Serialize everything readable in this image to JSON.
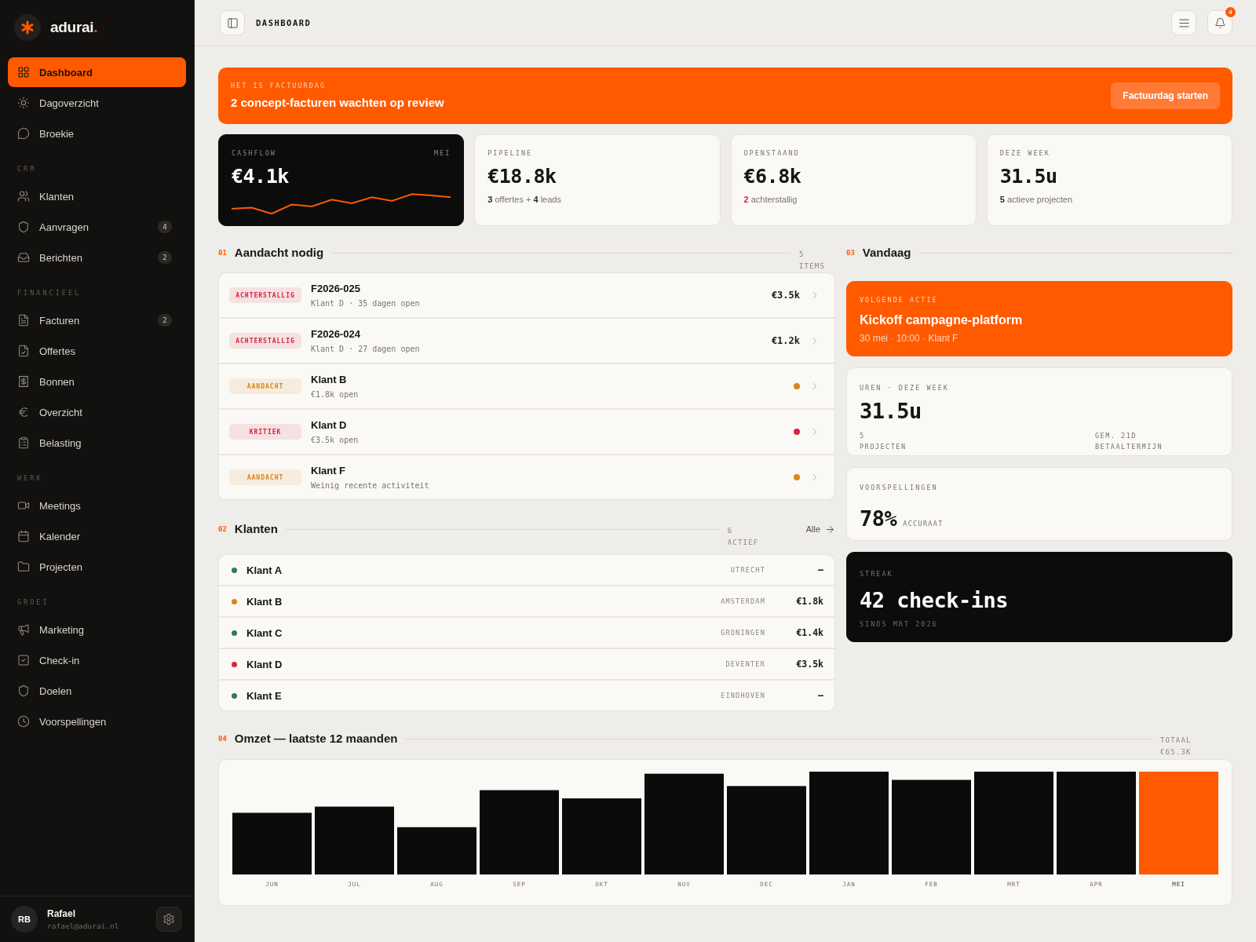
{
  "sidebar": {
    "brand": {
      "name": "adurai",
      "dot": "."
    },
    "groups": [
      {
        "items": [
          {
            "label": "Dashboard",
            "selected": true
          },
          {
            "label": "Dagoverzicht",
            "selected": false
          },
          {
            "label": "Broekie",
            "selected": false
          }
        ]
      },
      {
        "title": "CRM",
        "items": [
          {
            "label": "Klanten",
            "selected": false
          },
          {
            "label": "Aanvragen",
            "selected": false,
            "badge": "4"
          },
          {
            "label": "Berichten",
            "selected": false,
            "badge": "2"
          }
        ]
      },
      {
        "title": "FINANCIEEL",
        "items": [
          {
            "label": "Facturen",
            "selected": false,
            "badge": "2"
          },
          {
            "label": "Offertes",
            "selected": false
          },
          {
            "label": "Bonnen",
            "selected": false
          },
          {
            "label": "Overzicht",
            "selected": false
          },
          {
            "label": "Belasting",
            "selected": false
          }
        ]
      },
      {
        "title": "WERK",
        "items": [
          {
            "label": "Meetings",
            "selected": false
          },
          {
            "label": "Kalender",
            "selected": false
          },
          {
            "label": "Projecten",
            "selected": false
          }
        ]
      },
      {
        "title": "GROEI",
        "items": [
          {
            "label": "Marketing",
            "selected": false
          },
          {
            "label": "Check-in",
            "selected": false
          },
          {
            "label": "Doelen",
            "selected": false
          },
          {
            "label": "Voorspellingen",
            "selected": false
          }
        ]
      }
    ],
    "user": {
      "initials": "RB",
      "name": "Rafael",
      "email": "rafael@adurai.nl"
    }
  },
  "topbar": {
    "title": "DASHBOARD",
    "notifications": "4"
  },
  "banner": {
    "eyebrow": "HET IS FACTUURDAG",
    "title": "2 concept-facturen wachten op review",
    "button": "Factuurdag starten"
  },
  "stats": [
    {
      "kind": "sparkline",
      "label": "CASHFLOW",
      "tag": "MEI",
      "value": "€4.1k"
    },
    {
      "kind": "metric",
      "label": "PIPELINE",
      "value": "€18.8k",
      "note": "**3** offertes + **4** leads",
      "alert": false
    },
    {
      "kind": "metric",
      "label": "OPENSTAAND",
      "value": "€6.8k",
      "note": "**2** achterstallig",
      "alert": true
    },
    {
      "kind": "metric",
      "label": "DEZE WEEK",
      "value": "31.5u",
      "note": "**5** actieve projecten",
      "alert": false
    }
  ],
  "attention": {
    "number": "01",
    "title": "Aandacht nodig",
    "count": "5 ITEMS",
    "rows": [
      {
        "kind": "amount",
        "tag": "ACHTERSTALLIG",
        "color": "#d6263f",
        "title": "F2026-025",
        "subtitle": "Klant D · 35 dagen open",
        "amount": "€3.5k"
      },
      {
        "kind": "amount",
        "tag": "ACHTERSTALLIG",
        "color": "#d6263f",
        "title": "F2026-024",
        "subtitle": "Klant D · 27 dagen open",
        "amount": "€1.2k"
      },
      {
        "kind": "status",
        "tag": "AANDACHT",
        "color": "#d9861a",
        "title": "Klant B",
        "subtitle": "€1.8k open"
      },
      {
        "kind": "status",
        "tag": "KRITIEK",
        "color": "#d6263f",
        "title": "Klant D",
        "subtitle": "€3.5k open"
      },
      {
        "kind": "status",
        "tag": "AANDACHT",
        "color": "#d9861a",
        "title": "Klant F",
        "subtitle": "Weinig recente activiteit"
      }
    ]
  },
  "clients": {
    "number": "02",
    "title": "Klanten",
    "count": "6 ACTIEF",
    "link": "Alle",
    "rows": [
      {
        "name": "Klant A",
        "color": "#2f7a58",
        "city": "UTRECHT",
        "amount": "–"
      },
      {
        "name": "Klant B",
        "color": "#d9861a",
        "city": "AMSTERDAM",
        "amount": "€1.8k"
      },
      {
        "name": "Klant C",
        "color": "#2f7a58",
        "city": "GRONINGEN",
        "amount": "€1.4k"
      },
      {
        "name": "Klant D",
        "color": "#d6263f",
        "city": "DEVENTER",
        "amount": "€3.5k"
      },
      {
        "name": "Klant E",
        "color": "#2f7a58",
        "city": "EINDHOVEN",
        "amount": "–"
      }
    ]
  },
  "today": {
    "number": "03",
    "title": "Vandaag",
    "cards": [
      {
        "kind": "action",
        "label": "VOLGENDE ACTIE",
        "title": "Kickoff campagne-platform",
        "meta": "30 mei · 10:00 · Klant F"
      },
      {
        "kind": "hours",
        "label": "UREN · DEZE WEEK",
        "value": "31.5u",
        "left": "5 PROJECTEN",
        "right": "GEM. 21D BETAALTERMIJN"
      },
      {
        "kind": "forecast",
        "label": "VOORSPELLINGEN",
        "value": "78%",
        "unit": "ACCURAAT"
      },
      {
        "kind": "streak",
        "label": "STREAK",
        "value": "42 check-ins",
        "meta": "SINDS MRT 2026"
      }
    ]
  },
  "revenue": {
    "number": "04",
    "title": "Omzet — laatste 12 maanden",
    "total": "TOTAAL €65.3K",
    "months": [
      {
        "label": "JUN",
        "selected": false
      },
      {
        "label": "JUL",
        "selected": false
      },
      {
        "label": "AUG",
        "selected": false
      },
      {
        "label": "SEP",
        "selected": false
      },
      {
        "label": "OKT",
        "selected": false
      },
      {
        "label": "NOV",
        "selected": false
      },
      {
        "label": "DEC",
        "selected": false
      },
      {
        "label": "JAN",
        "selected": false
      },
      {
        "label": "FEB",
        "selected": false
      },
      {
        "label": "MRT",
        "selected": false
      },
      {
        "label": "APR",
        "selected": false
      },
      {
        "label": "MEI",
        "selected": true
      }
    ]
  }
}
